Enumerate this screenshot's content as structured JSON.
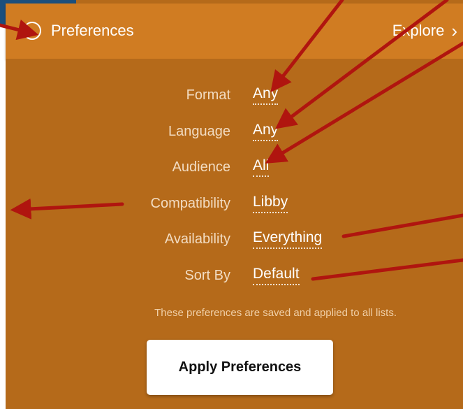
{
  "header": {
    "title": "Preferences",
    "explore_label": "Explore",
    "chevron": "›"
  },
  "preferences": [
    {
      "label": "Format",
      "value": "Any"
    },
    {
      "label": "Language",
      "value": "Any"
    },
    {
      "label": "Audience",
      "value": "All"
    },
    {
      "label": "Compatibility",
      "value": "Libby"
    },
    {
      "label": "Availability",
      "value": "Everything"
    },
    {
      "label": "Sort By",
      "value": "Default"
    }
  ],
  "note": "These preferences are saved and applied to all lists.",
  "apply_button": "Apply Preferences",
  "colors": {
    "header": "#d07c22",
    "panel": "#b56a1a",
    "corner": "#1b4f7d",
    "annotation_arrow": "#b0150f"
  }
}
